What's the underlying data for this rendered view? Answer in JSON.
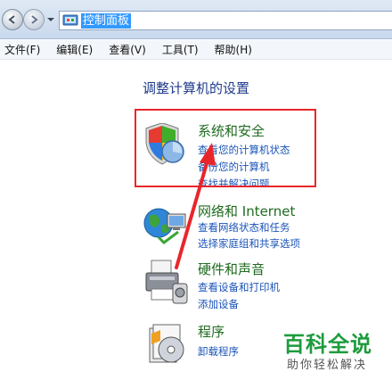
{
  "address_bar": {
    "path": "控制面板"
  },
  "menu": [
    "文件(F)",
    "编辑(E)",
    "查看(V)",
    "工具(T)",
    "帮助(H)"
  ],
  "heading": "调整计算机的设置",
  "categories": [
    {
      "title": "系统和安全",
      "links": [
        "查看您的计算机状态",
        "备份您的计算机",
        "查找并解决问题"
      ]
    },
    {
      "title": "网络和 Internet",
      "links": [
        "查看网络状态和任务",
        "选择家庭组和共享选项"
      ]
    },
    {
      "title": "硬件和声音",
      "links": [
        "查看设备和打印机",
        "添加设备"
      ]
    },
    {
      "title": "程序",
      "links": [
        "卸载程序"
      ]
    }
  ],
  "watermark": {
    "title": "百科全说",
    "subtitle": "助你轻松解决"
  },
  "colors": {
    "highlight": "#e8262a",
    "category": "#1f6b1f",
    "link": "#1b54b8",
    "watermark": "#1e9b3d"
  }
}
